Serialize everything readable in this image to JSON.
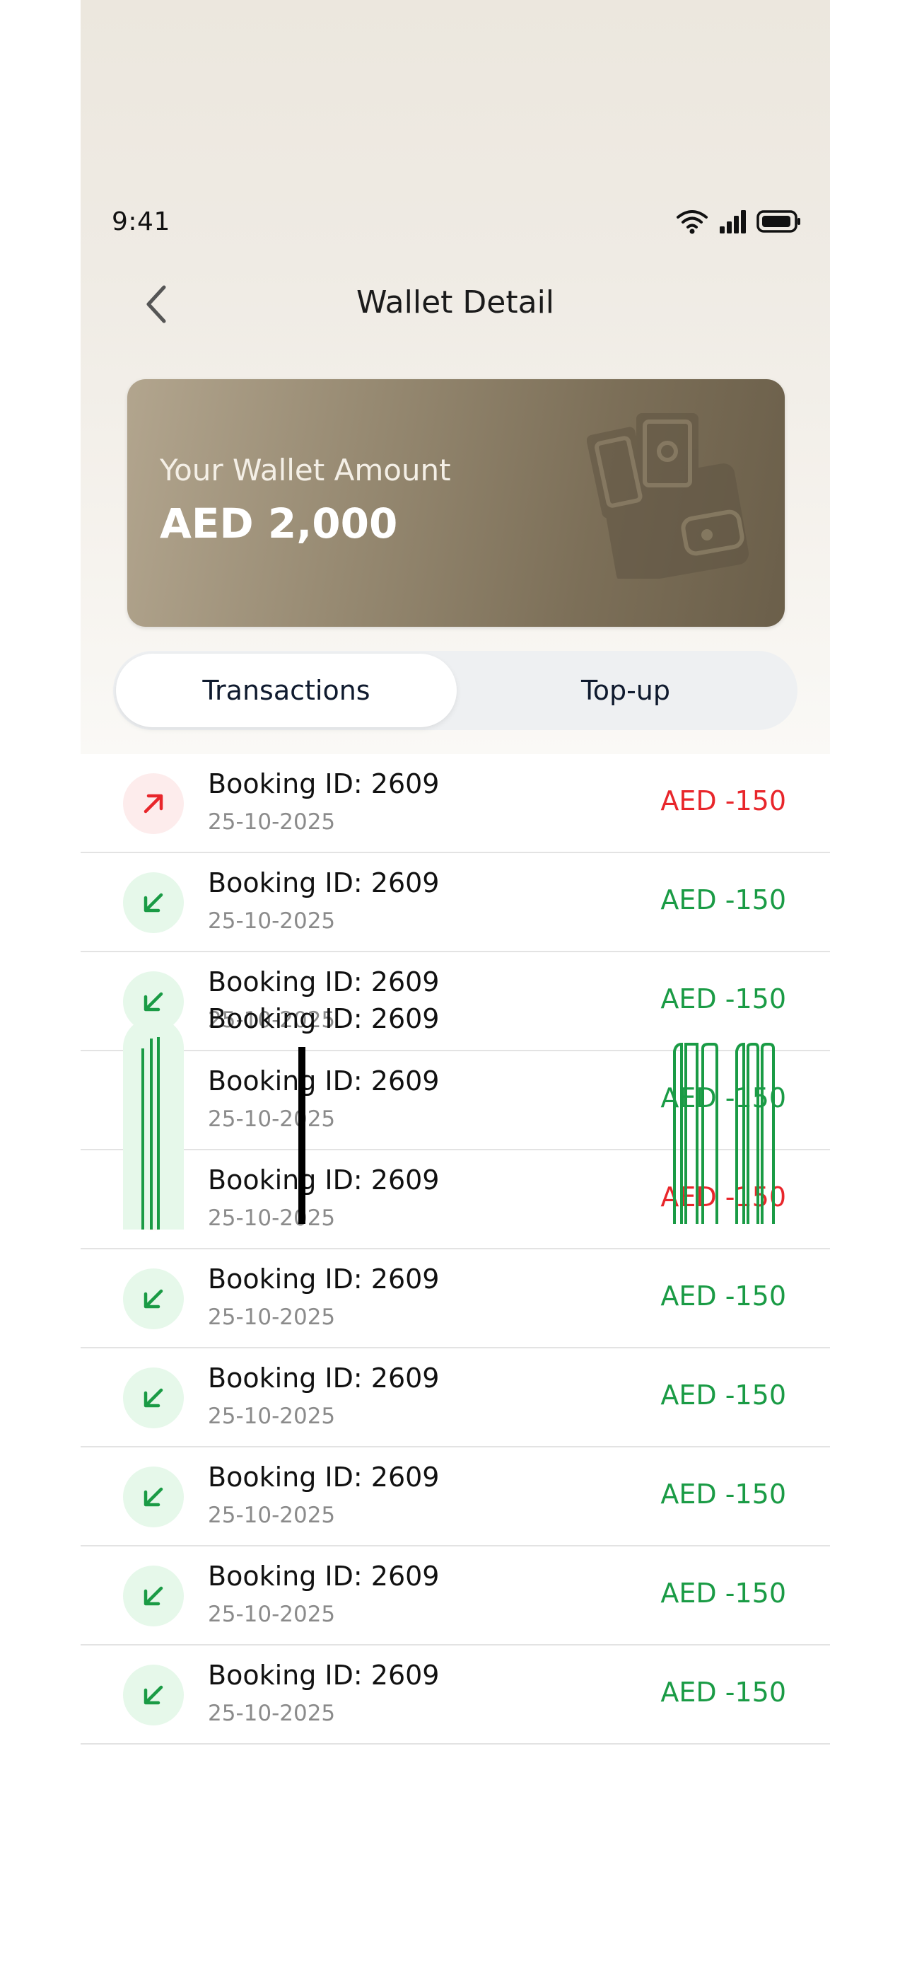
{
  "status_bar": {
    "time": "9:41"
  },
  "header": {
    "title": "Wallet Detail",
    "back_icon": "chevron-left-icon"
  },
  "wallet_card": {
    "label": "Your Wallet Amount",
    "amount": "AED 2,000",
    "icon": "wallet-with-cash-icon"
  },
  "tabs": [
    {
      "label": "Transactions",
      "active": true
    },
    {
      "label": "Top-up",
      "active": false
    }
  ],
  "transactions": [
    {
      "title": "Booking ID: 2609",
      "date": "25-10-2025",
      "amount": "AED -150",
      "direction": "out"
    },
    {
      "title": "Booking ID: 2609",
      "date": "25-10-2025",
      "amount": "AED -150",
      "direction": "in"
    },
    {
      "title": "Booking ID: 2609",
      "date": "25-10-2025",
      "amount": "AED -150",
      "direction": "in"
    },
    {
      "title": "Booking ID: 2609",
      "date": "25-10-2025",
      "amount": "AED -150",
      "direction": "in"
    },
    {
      "title": "Booking ID: 2609",
      "date": "25-10-2025",
      "amount": "AED -150",
      "direction": "out"
    },
    {
      "title": "Booking ID: 2609",
      "date": "25-10-2025",
      "amount": "AED -150",
      "direction": "in"
    },
    {
      "title": "Booking ID: 2609",
      "date": "25-10-2025",
      "amount": "AED -150",
      "direction": "in"
    },
    {
      "title": "Booking ID: 2609",
      "date": "25-10-2025",
      "amount": "AED -150",
      "direction": "in"
    },
    {
      "title": "Booking ID: 2609",
      "date": "25-10-2025",
      "amount": "AED -150",
      "direction": "in"
    },
    {
      "title": "Booking ID: 2609",
      "date": "25-10-2025",
      "amount": "AED -150",
      "direction": "in"
    }
  ],
  "partial_row": {
    "title": "Booking ID: 2609"
  },
  "colors": {
    "out": "#e8262b",
    "in": "#1a9b45",
    "card": "#8c7f67"
  }
}
